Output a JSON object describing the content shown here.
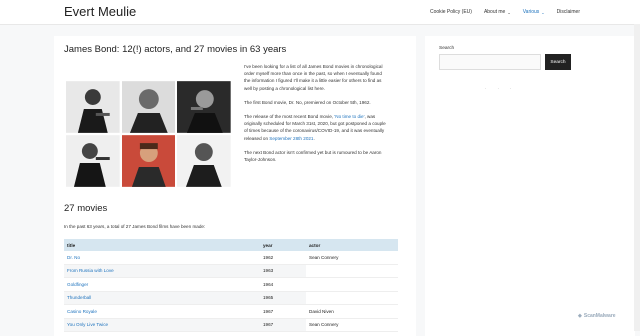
{
  "site": {
    "title": "Evert Meulie"
  },
  "nav": [
    {
      "label": "Cookie Policy (EU)",
      "dropdown": false,
      "active": false
    },
    {
      "label": "About me",
      "dropdown": true,
      "active": false
    },
    {
      "label": "Various",
      "dropdown": true,
      "active": true
    },
    {
      "label": "Disclaimer",
      "dropdown": false,
      "active": false
    }
  ],
  "article": {
    "title": "James Bond: 12(!) actors, and 27 movies in 63 years",
    "intro_1": "I've been looking for a list of all James Bond movies in chronological order myself more than once in the past, so when I eventually found the information I figured I'll make it a little easier for others to find as well by posting a chronological list here.",
    "intro_2": "The first Bond movie, Dr. No, premiered on October 5th, 1962.",
    "intro_3a": "The release of the most recent Bond movie, ",
    "intro_3_link": "'No time to die'",
    "intro_3b": ", was originally scheduled for March 31st, 2020, but got postponed a couple of times because of the coronavirus/COVID-19, and it was eventually released on ",
    "intro_3_date": "September 28th 2021",
    "intro_3c": ".",
    "intro_4": "The next Bond actor isn't confirmed yet but is rumoured to be Aaron Taylor-Johnson.",
    "section_title": "27 movies",
    "section_lead": "In the past 63 years, a total of 27 James Bond films have been made:"
  },
  "table": {
    "headers": [
      "title",
      "year",
      "actor"
    ],
    "rows": [
      {
        "title": "Dr. No",
        "year": "1962",
        "actor": "Sean Connery"
      },
      {
        "title": "From Russia with Love",
        "year": "1963",
        "actor": ""
      },
      {
        "title": "Goldfinger",
        "year": "1964",
        "actor": ""
      },
      {
        "title": "Thunderball",
        "year": "1965",
        "actor": ""
      },
      {
        "title": "Casino Royale",
        "year": "1967",
        "actor": "David Niven"
      },
      {
        "title": "You Only Live Twice",
        "year": "1967",
        "actor": "Sean Connery"
      }
    ]
  },
  "sidebar": {
    "search_label": "Search",
    "search_button": "Search",
    "search_value": ""
  },
  "watermark": "ScanMalware",
  "colors": {
    "link": "#1e73be",
    "table_header": "#d6e6f0",
    "button": "#222222"
  }
}
